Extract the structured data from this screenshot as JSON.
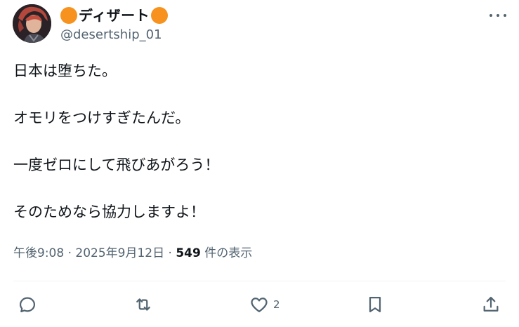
{
  "user": {
    "display_name": "ディザート",
    "handle": "@desertship_01"
  },
  "tweet": {
    "paragraphs": [
      "日本は堕ちた。",
      "オモリをつけすぎたんだ。",
      "一度ゼロにして飛びあがろう！",
      "そのためなら協力しますよ！"
    ]
  },
  "meta": {
    "time": "午後9:08",
    "separator1": " · ",
    "date": "2025年9月12日",
    "separator2": " · ",
    "views_count": "549",
    "views_label": " 件の表示"
  },
  "actions": {
    "reply_icon": "reply-icon",
    "retweet_icon": "retweet-icon",
    "like_icon": "heart-icon",
    "like_count": "2",
    "bookmark_icon": "bookmark-icon",
    "share_icon": "share-icon"
  },
  "colors": {
    "text": "#0f1419",
    "secondary": "#536471",
    "emoji_orange": "#f7921e",
    "divider": "#eff3f4"
  }
}
